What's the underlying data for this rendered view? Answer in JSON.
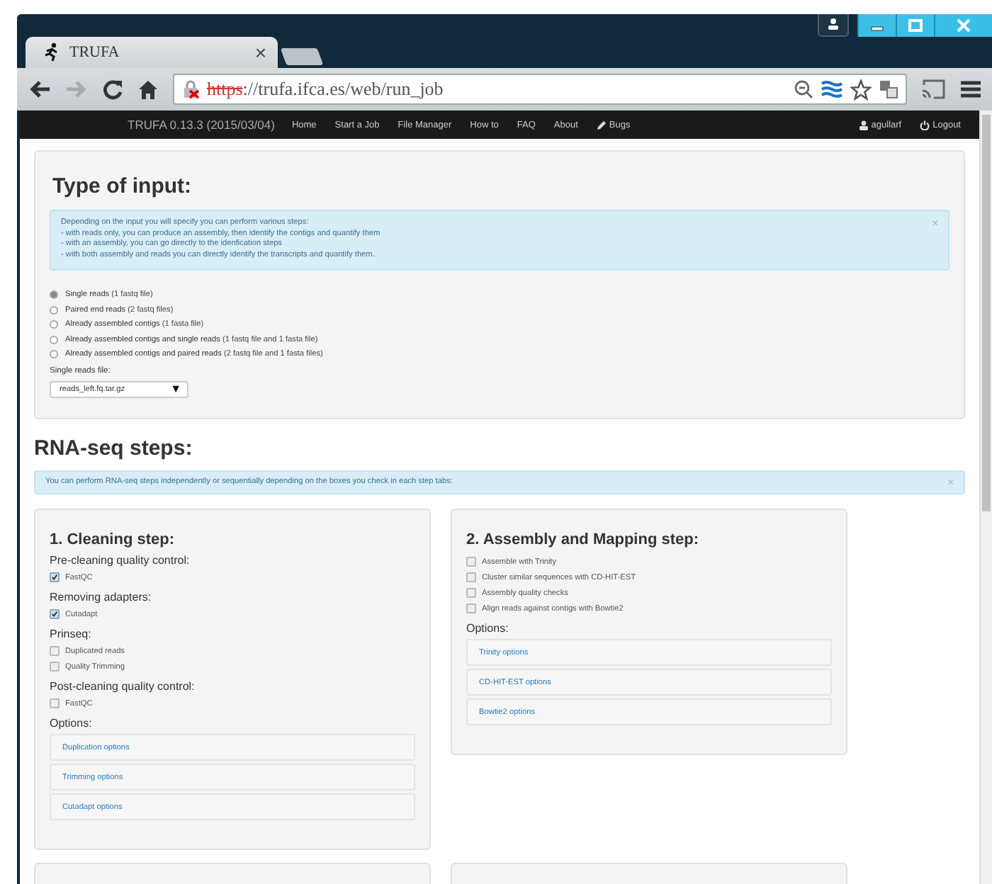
{
  "browser": {
    "tab_title": "TRUFA",
    "tab_close": "×",
    "url_scheme": "https",
    "url_rest": "://trufa.ifca.es/web/run_job",
    "forward_disabled": true
  },
  "navbar": {
    "brand": "TRUFA 0.13.3 (2015/03/04)",
    "links": [
      {
        "label": "Home",
        "kind": "plain"
      },
      {
        "label": "Start a Job",
        "kind": "plain"
      },
      {
        "label": "File Manager",
        "kind": "plain"
      },
      {
        "label": "How to",
        "kind": "plain"
      },
      {
        "label": "FAQ",
        "kind": "plain"
      },
      {
        "label": "About",
        "kind": "plain"
      },
      {
        "label": "Bugs",
        "kind": "bug"
      }
    ],
    "user": "agullarf",
    "logout": "Logout"
  },
  "input_panel": {
    "heading": "Type of input:",
    "alert": {
      "lines": [
        "Depending on the input you will specify you can perform various steps:",
        "- with reads only, you can produce an assembly, then identify the contigs and quantify them",
        "- with an assembly, you can go directly to the idenfication steps",
        "- with both assembly and reads you can directly identify the transcripts and quantify them."
      ],
      "close": "×"
    },
    "options": [
      {
        "label": "Single reads",
        "note": "(1 fastq file)",
        "selected": true
      },
      {
        "label": "Paired end reads",
        "note": "(2 fastq files)",
        "selected": false
      },
      {
        "label": "Already assembled contigs",
        "note": "(1 fasta file)",
        "selected": false
      },
      {
        "label": "Already assembled contigs and single reads",
        "note": "(1 fastq file and 1 fasta file)",
        "selected": false
      },
      {
        "label": "Already assembled contigs and paired reads",
        "note": "(2 fastq file and 1 fasta files)",
        "selected": false
      }
    ],
    "file_label": "Single reads file:",
    "file_value": "reads_left.fq.tar.gz",
    "file_caret": "▼"
  },
  "steps_heading": "RNA-seq steps:",
  "steps_alert": {
    "text": "You can perform RNA-seq steps independently or sequentially depending on the boxes you check in each step tabs:",
    "close": "×"
  },
  "steps": [
    {
      "title": "1. Cleaning step:",
      "items": [
        {
          "kind": "subheading",
          "label": "Pre-cleaning quality control:"
        },
        {
          "kind": "checkbox",
          "label": "FastQC",
          "checked": true
        },
        {
          "kind": "subheading",
          "label": "Removing adapters:"
        },
        {
          "kind": "checkbox",
          "label": "Cutadapt",
          "checked": true
        },
        {
          "kind": "subheading",
          "label": "Prinseq:"
        },
        {
          "kind": "checkbox",
          "label": "Duplicated reads",
          "checked": false
        },
        {
          "kind": "checkbox",
          "label": "Quality Trimming",
          "checked": false
        },
        {
          "kind": "subheading",
          "label": "Post-cleaning quality control:"
        },
        {
          "kind": "checkbox",
          "label": "FastQC",
          "checked": false
        }
      ],
      "options_label": "Options:",
      "option_links": [
        "Duplication options",
        "Trimming options",
        "Cutadapt options"
      ]
    },
    {
      "title": "2. Assembly and Mapping step:",
      "items": [
        {
          "kind": "checkbox",
          "label": "Assemble with Trinity",
          "checked": false
        },
        {
          "kind": "checkbox",
          "label": "Cluster similar sequences with CD-HIT-EST",
          "checked": false
        },
        {
          "kind": "checkbox",
          "label": "Assembly quality checks",
          "checked": false
        },
        {
          "kind": "checkbox",
          "label": "Align reads against contigs with Bowtie2",
          "checked": false
        }
      ],
      "options_label": "Options:",
      "option_links": [
        "Trinity options",
        "CD-HIT-EST options",
        "Bowtie2 options"
      ]
    }
  ]
}
